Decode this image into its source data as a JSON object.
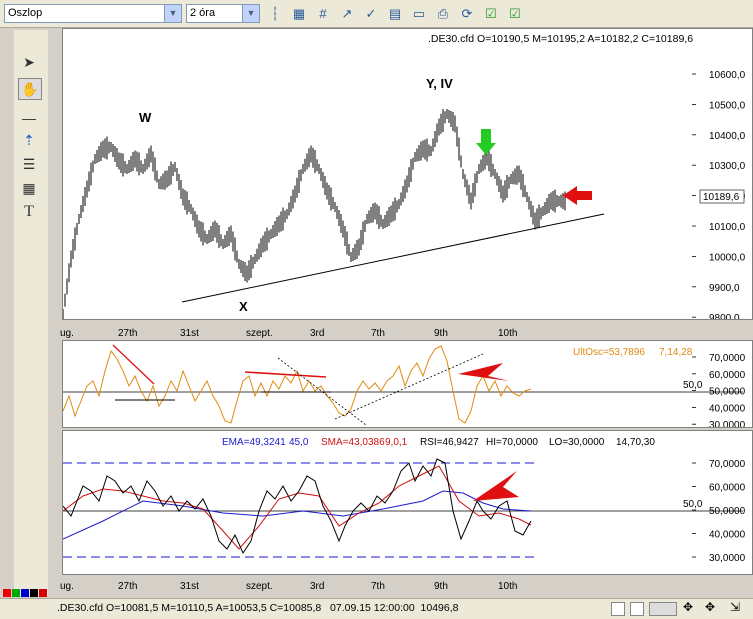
{
  "toolbar": {
    "chart_type_value": "Oszlop",
    "timeframe_value": "2 óra",
    "icons": [
      "bar-chart-icon",
      "grid-icon",
      "line-chart-icon",
      "candle-chart-icon",
      "new-chart-icon",
      "properties-icon",
      "print-icon",
      "refresh-icon",
      "checkbox-icon",
      "info-icon"
    ]
  },
  "left_tools": [
    "cursor-icon",
    "hand-icon",
    "line-tool-icon",
    "arrow-tool-icon",
    "fib-icon",
    "grid-tool-icon",
    "text-tool-icon"
  ],
  "price_panel": {
    "info": ".DE30.cfd O=10190,5 M=10195,2 A=10182,2 C=10189,6",
    "y_ticks": [
      "10600,0",
      "10500,0",
      "10400,0",
      "10300,0",
      "10200,0",
      "10100,0",
      "10000,0",
      "9900,0",
      "9800,0"
    ],
    "current_price": "10189,6",
    "annotations": {
      "w": "W",
      "x": "X",
      "y": "Y, IV"
    }
  },
  "x_labels": [
    "ug.",
    "27th",
    "31st",
    "szept.",
    "3rd",
    "7th",
    "9th",
    "10th"
  ],
  "ult_panel": {
    "info_name": "UltOsc=53,7896",
    "info_params": "7,14,28",
    "level": "50,0",
    "y_ticks": [
      "70,0000",
      "60,0000",
      "50,0000",
      "40,0000",
      "30,0000"
    ]
  },
  "rsi_panel": {
    "ema": "EMA=49,3241",
    "ema_params": "45,0",
    "sma": "SMA=43,0386",
    "sma_params": "9,0,1",
    "rsi": "RSI=46,9427",
    "hi": "HI=70,0000",
    "lo": "LO=30,0000",
    "rsi_params": "14,70,30",
    "level": "50,0",
    "y_ticks": [
      "70,0000",
      "60,0000",
      "50,0000",
      "40,0000",
      "30,0000"
    ]
  },
  "status": {
    "text": ".DE30.cfd O=10081,5 M=10110,5 A=10053,5 C=10085,8   07.09.15 12:00:00  10496,8"
  },
  "colors": {
    "price_bars": "#000000",
    "ult_line": "#e08a10",
    "rsi_line": "#000000",
    "ema_line": "#1a1ad0",
    "sma_line": "#d01010",
    "hi_lo_lines": "#1a1ad0",
    "arrow_green": "#22cc22",
    "arrow_red": "#e01010",
    "trendline_red": "#e01010"
  }
}
